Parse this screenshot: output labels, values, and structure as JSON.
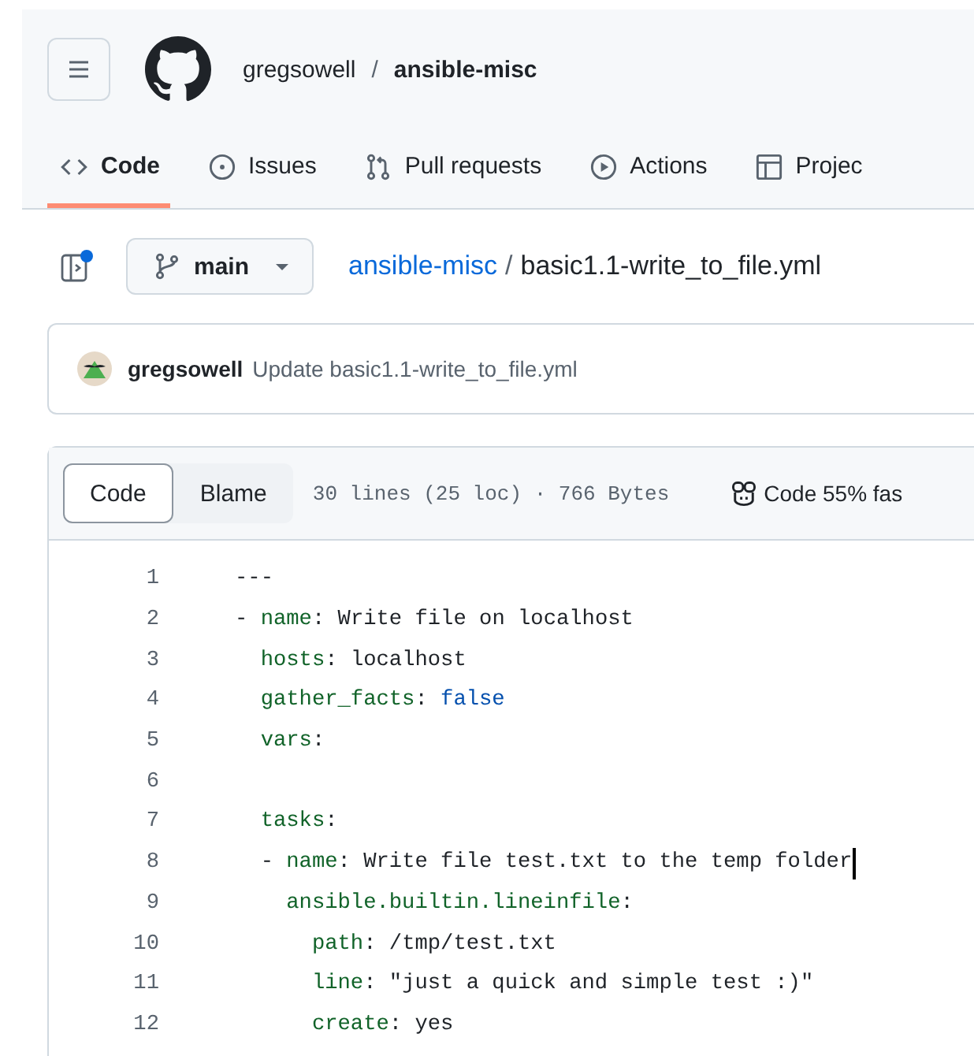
{
  "header": {
    "owner": "gregsowell",
    "separator": "/",
    "repo": "ansible-misc"
  },
  "tabs": [
    {
      "label": "Code",
      "selected": true
    },
    {
      "label": "Issues",
      "selected": false
    },
    {
      "label": "Pull requests",
      "selected": false
    },
    {
      "label": "Actions",
      "selected": false
    },
    {
      "label": "Projec",
      "selected": false
    }
  ],
  "file_bar": {
    "branch": "main",
    "path_repo": "ansible-misc",
    "path_separator": "/",
    "file_name": "basic1.1-write_to_file.yml"
  },
  "commit": {
    "author": "gregsowell",
    "message": "Update basic1.1-write_to_file.yml"
  },
  "code_view": {
    "modes": [
      {
        "label": "Code",
        "selected": true
      },
      {
        "label": "Blame",
        "selected": false
      }
    ],
    "info": "30 lines (25 loc) · 766 Bytes",
    "copilot": "Code 55% fas",
    "lines": [
      {
        "number": "1",
        "cursor": false,
        "tokens": [
          {
            "kind": "punct",
            "text": "---"
          }
        ]
      },
      {
        "number": "2",
        "cursor": false,
        "tokens": [
          {
            "kind": "punct",
            "text": "- "
          },
          {
            "kind": "key",
            "text": "name"
          },
          {
            "kind": "punct",
            "text": ": "
          },
          {
            "kind": "value",
            "text": "Write file on localhost"
          }
        ]
      },
      {
        "number": "3",
        "cursor": false,
        "tokens": [
          {
            "kind": "key",
            "text": "  hosts"
          },
          {
            "kind": "punct",
            "text": ": "
          },
          {
            "kind": "value",
            "text": "localhost"
          }
        ]
      },
      {
        "number": "4",
        "cursor": false,
        "tokens": [
          {
            "kind": "key",
            "text": "  gather_facts"
          },
          {
            "kind": "punct",
            "text": ": "
          },
          {
            "kind": "bool",
            "text": "false"
          }
        ]
      },
      {
        "number": "5",
        "cursor": false,
        "tokens": [
          {
            "kind": "key",
            "text": "  vars"
          },
          {
            "kind": "punct",
            "text": ":"
          }
        ]
      },
      {
        "number": "6",
        "cursor": false
      },
      {
        "number": "7",
        "cursor": false,
        "tokens": [
          {
            "kind": "key",
            "text": "  tasks"
          },
          {
            "kind": "punct",
            "text": ":"
          }
        ]
      },
      {
        "number": "8",
        "cursor": true,
        "tokens": [
          {
            "kind": "punct",
            "text": "  - "
          },
          {
            "kind": "key",
            "text": "name"
          },
          {
            "kind": "punct",
            "text": ": "
          },
          {
            "kind": "value",
            "text": "Write file test.txt to the temp folder"
          }
        ]
      },
      {
        "number": "9",
        "cursor": false,
        "tokens": [
          {
            "kind": "key",
            "text": "    ansible.builtin.lineinfile"
          },
          {
            "kind": "punct",
            "text": ":"
          }
        ]
      },
      {
        "number": "10",
        "cursor": false,
        "tokens": [
          {
            "kind": "key",
            "text": "      path"
          },
          {
            "kind": "punct",
            "text": ": "
          },
          {
            "kind": "value",
            "text": "/tmp/test.txt"
          }
        ]
      },
      {
        "number": "11",
        "cursor": false,
        "tokens": [
          {
            "kind": "key",
            "text": "      line"
          },
          {
            "kind": "punct",
            "text": ": "
          },
          {
            "kind": "value",
            "text": "\"just a quick and simple test :)\""
          }
        ]
      },
      {
        "number": "12",
        "cursor": false,
        "tokens": [
          {
            "kind": "key",
            "text": "      create"
          },
          {
            "kind": "punct",
            "text": ": "
          },
          {
            "kind": "value",
            "text": "yes"
          }
        ]
      }
    ]
  }
}
